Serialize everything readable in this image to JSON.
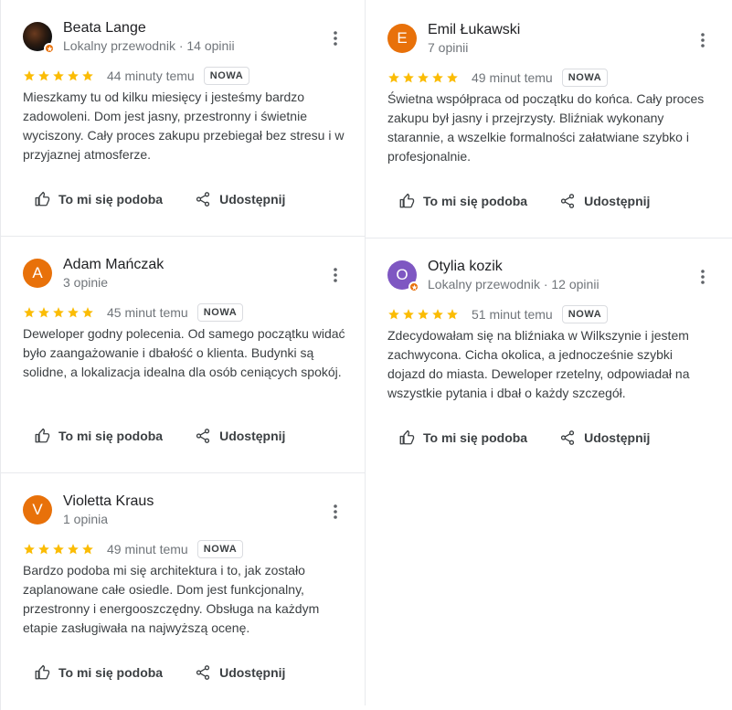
{
  "colors": {
    "star": "#fbbc04",
    "avatar_orange": "#e8710a",
    "avatar_purple": "#7e57c2"
  },
  "actions": {
    "like": "To mi się podoba",
    "share": "Udostępnij"
  },
  "reviews": [
    {
      "name": "Beata Lange",
      "meta": "Lokalny przewodnik · 14 opinii",
      "avatar_letter": "",
      "avatar_type": "photo",
      "local_guide": true,
      "stars": 5,
      "time": "44 minuty temu",
      "badge": "NOWA",
      "text": "Mieszkamy tu od kilku miesięcy i jesteśmy bardzo zadowoleni. Dom jest jasny, przestronny i świetnie wyciszony. Cały proces zakupu przebiegał bez stresu i w przyjaznej atmosferze."
    },
    {
      "name": "Adam Mańczak",
      "meta": "3 opinie",
      "avatar_letter": "A",
      "avatar_type": "orange",
      "local_guide": false,
      "stars": 5,
      "time": "45 minut temu",
      "badge": "NOWA",
      "text": "Deweloper godny polecenia. Od samego początku widać było zaangażowanie i dbałość o klienta. Budynki są solidne, a lokalizacja idealna dla osób ceniących spokój."
    },
    {
      "name": "Violetta Kraus",
      "meta": "1 opinia",
      "avatar_letter": "V",
      "avatar_type": "orange",
      "local_guide": false,
      "stars": 5,
      "time": "49 minut temu",
      "badge": "NOWA",
      "text": "Bardzo podoba mi się architektura i to, jak zostało zaplanowane całe osiedle. Dom jest funkcjonalny, przestronny i energooszczędny. Obsługa na każdym etapie zasługiwała na najwyższą ocenę."
    },
    {
      "name": "Emil Łukawski",
      "meta": "7 opinii",
      "avatar_letter": "E",
      "avatar_type": "orange",
      "local_guide": false,
      "stars": 5,
      "time": "49 minut temu",
      "badge": "NOWA",
      "text": "Świetna współpraca od początku do końca. Cały proces zakupu był jasny i przejrzysty. Bliźniak wykonany starannie, a wszelkie formalności załatwiane szybko i profesjonalnie."
    },
    {
      "name": "Otylia kozik",
      "meta": "Lokalny przewodnik · 12 opinii",
      "avatar_letter": "O",
      "avatar_type": "purple",
      "local_guide": true,
      "stars": 5,
      "time": "51 minut temu",
      "badge": "NOWA",
      "text": "Zdecydowałam się na bliźniaka w Wilkszynie i jestem zachwycona. Cicha okolica, a jednocześnie szybki dojazd do miasta. Deweloper rzetelny, odpowiadał na wszystkie pytania i dbał o każdy szczegół."
    }
  ]
}
